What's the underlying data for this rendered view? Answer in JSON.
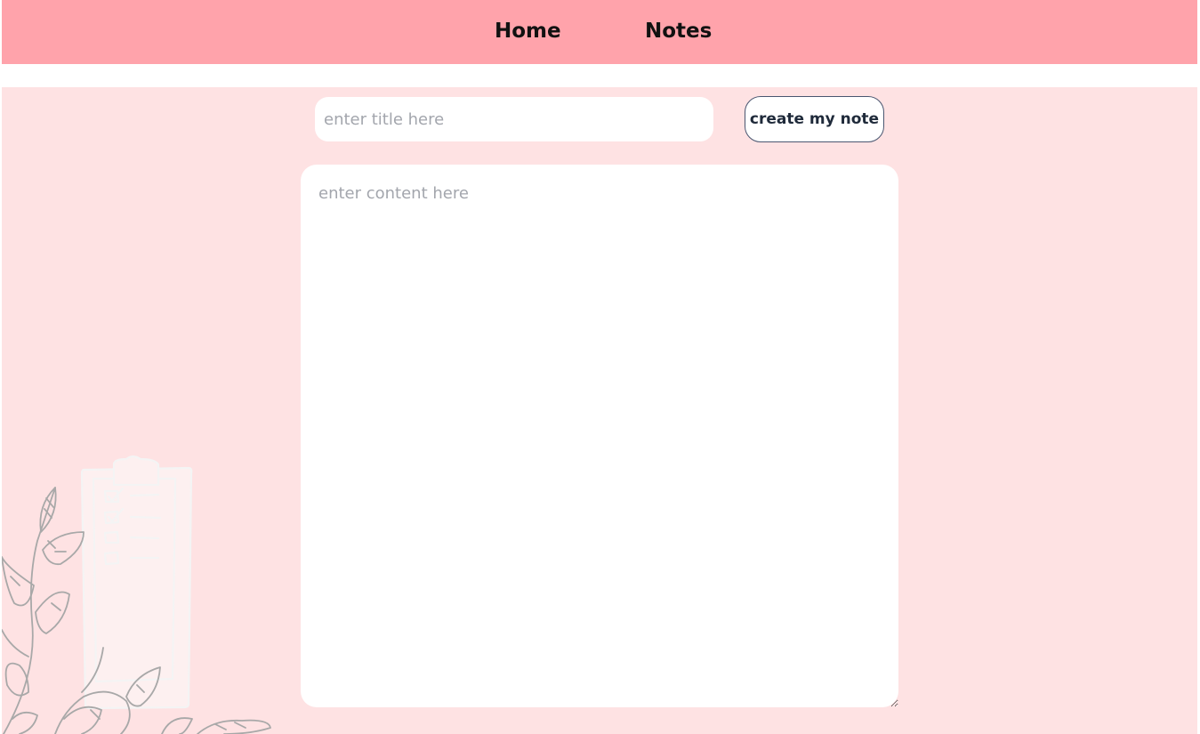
{
  "nav": {
    "home_label": "Home",
    "notes_label": "Notes"
  },
  "form": {
    "title_placeholder": "enter title here",
    "content_placeholder": "enter content here",
    "submit_label": "create my note"
  },
  "colors": {
    "navbar_bg": "#ffa3ab",
    "main_bg": "#fee2e3",
    "input_bg": "#ffffff",
    "button_border": "#4a5670"
  },
  "icons": {
    "decoration": "clipboard-checklist-with-leaves-illustration"
  }
}
